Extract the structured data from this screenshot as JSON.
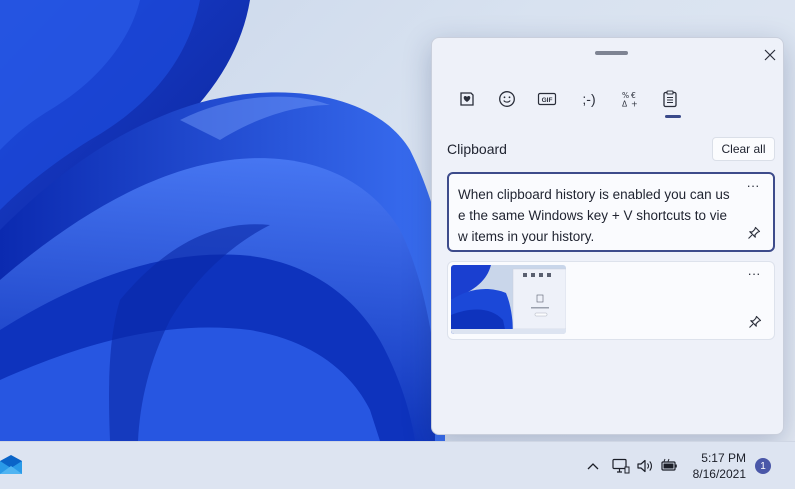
{
  "clipboard_panel": {
    "tabs": [
      {
        "name": "emoji-favorites",
        "icon": "heart-sticker-icon"
      },
      {
        "name": "emoji",
        "icon": "smiley-icon"
      },
      {
        "name": "gif",
        "icon": "gif-icon",
        "label": "GIF"
      },
      {
        "name": "kaomoji",
        "icon": "kaomoji-icon",
        "label": ";-)"
      },
      {
        "name": "symbols",
        "icon": "symbols-icon"
      },
      {
        "name": "clipboard",
        "icon": "clipboard-icon",
        "selected": true
      }
    ],
    "section_title": "Clipboard",
    "clear_all_label": "Clear all",
    "items": [
      {
        "type": "text",
        "text": "When clipboard history is enabled you can use the same Windows key + V shortcuts to view items in your history.",
        "more_label": "···"
      },
      {
        "type": "image",
        "description": "desktop-screenshot-thumbnail",
        "more_label": "···"
      }
    ]
  },
  "taskbar": {
    "time": "5:17 PM",
    "date": "8/16/2021",
    "notification_count": "1",
    "tray_icons": [
      "chevron-up-icon",
      "network-icon",
      "volume-icon",
      "battery-icon"
    ],
    "pinned_app": "mail-icon"
  },
  "colors": {
    "accent": "#3d4b8b",
    "bloom_dark": "#0a2fb5",
    "bloom_light": "#3f6df0"
  }
}
